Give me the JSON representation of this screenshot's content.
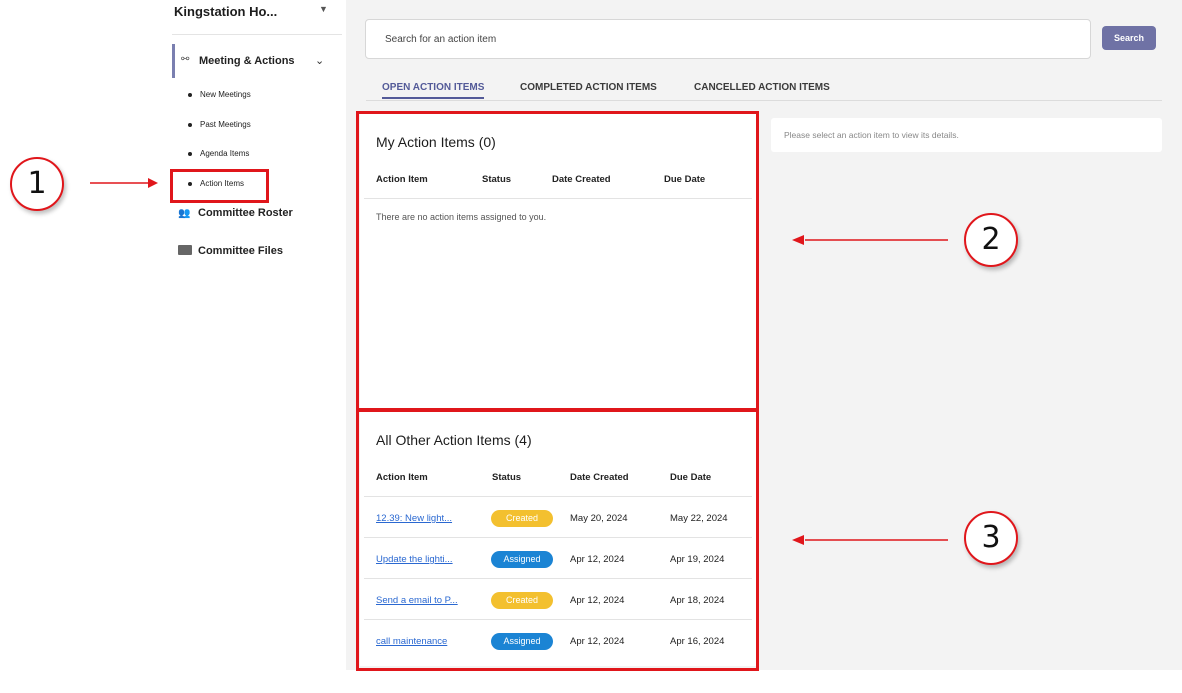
{
  "sidebar": {
    "org_name": "Kingstation Ho...",
    "meetings_label": "Meeting & Actions",
    "sub_items": [
      "New Meetings",
      "Past Meetings",
      "Agenda Items",
      "Action Items"
    ],
    "roster_label": "Committee Roster",
    "files_label": "Committee Files",
    "icons": {
      "caret": "caret-down-icon",
      "meetings": "meetings-icon",
      "chevron": "chevron-down-icon",
      "roster": "people-icon",
      "files": "folder-icon"
    }
  },
  "search": {
    "placeholder": "Search for an action item",
    "button": "Search"
  },
  "tabs": [
    "OPEN ACTION ITEMS",
    "COMPLETED ACTION ITEMS",
    "CANCELLED ACTION ITEMS"
  ],
  "detail_placeholder": "Please select an action item to view its details.",
  "my_items": {
    "title": "My Action Items (0)",
    "columns": [
      "Action Item",
      "Status",
      "Date Created",
      "Due Date"
    ],
    "empty_message": "There are no action items assigned to you."
  },
  "other_items": {
    "title": "All Other Action Items (4)",
    "columns": [
      "Action Item",
      "Status",
      "Date Created",
      "Due Date"
    ],
    "rows": [
      {
        "item": "12.39: New light...",
        "status": "Created",
        "created": "May 20, 2024",
        "due": "May 22, 2024"
      },
      {
        "item": "Update the lighti...",
        "status": "Assigned",
        "created": "Apr 12, 2024",
        "due": "Apr 19, 2024"
      },
      {
        "item": "Send a email to P...",
        "status": "Created",
        "created": "Apr 12, 2024",
        "due": "Apr 18, 2024"
      },
      {
        "item": "call maintenance",
        "status": "Assigned",
        "created": "Apr 12, 2024",
        "due": "Apr 16, 2024"
      }
    ]
  },
  "annotations": [
    "1",
    "2",
    "3"
  ],
  "colors": {
    "accent": "#535a98",
    "button": "#6f72a5",
    "created": "#f3c02f",
    "assigned": "#1b84d4",
    "annotation": "#e0161b",
    "link": "#2a68d1"
  }
}
